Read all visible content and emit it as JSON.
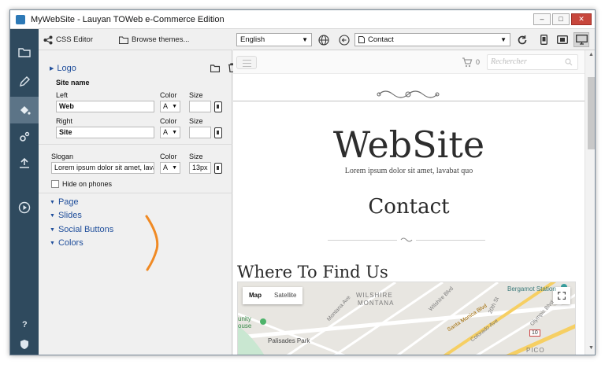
{
  "window": {
    "title": "MyWebSite - Lauyan TOWeb e-Commerce Edition"
  },
  "left_toolbar": {
    "css_editor": "CSS Editor",
    "browse_themes": "Browse themes..."
  },
  "logo": {
    "heading": "Logo",
    "site_name": "Site name",
    "left_label": "Left",
    "left_value": "Web",
    "right_label": "Right",
    "right_value": "Site",
    "color_label": "Color",
    "size_label": "Size",
    "color_value": "A"
  },
  "slogan": {
    "label": "Slogan",
    "value": "Lorem ipsum dolor sit amet, lava",
    "color_label": "Color",
    "size_label": "Size",
    "color_value": "A",
    "size_value": "13px",
    "hide_on_phones": "Hide on phones"
  },
  "sections": [
    "Page",
    "Slides",
    "Social Buttons",
    "Colors"
  ],
  "right_toolbar": {
    "language": "English",
    "page": "Contact"
  },
  "preview": {
    "search_placeholder": "Rechercher",
    "cart_count": "0",
    "brand": "WebSite",
    "tagline": "Lorem ipsum dolor sit amet, lavabat quo",
    "page_title": "Contact",
    "section_title": "Where To Find Us",
    "map": {
      "tab_map": "Map",
      "tab_satellite": "Satellite",
      "labels": [
        "WILSHIRE",
        "MONTANA",
        "Bergamot Station",
        "Santa Monica Blvd",
        "Palisades Park",
        "Wilshire Blvd",
        "Montana Ave",
        "Colorado Ave",
        "Olympic Blvd",
        "20th St",
        "unity",
        "ouse",
        "PICO",
        "10"
      ]
    }
  },
  "colors": {
    "rail": "#2f4a5e",
    "rail_active": "#5c7487",
    "link": "#1f4e9b",
    "annotation": "#f08a24"
  }
}
